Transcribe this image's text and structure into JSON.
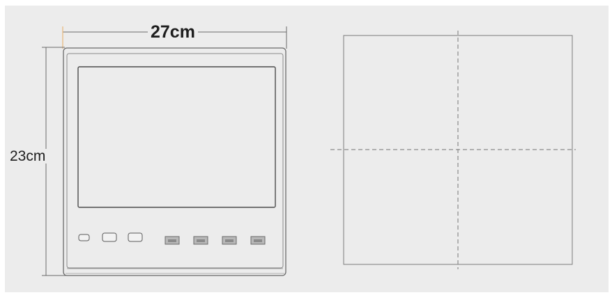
{
  "dimensions": {
    "width_label": "27cm",
    "height_label": "23cm"
  },
  "colors": {
    "background": "#ececec",
    "line": "#5a5a5a",
    "dashed": "#8a8a8a",
    "button_fill": "#b8b8b8",
    "accent_tick": "#e8b878"
  },
  "device": {
    "buttons": [
      {
        "name": "left-key-1",
        "style": "outline"
      },
      {
        "name": "left-key-2",
        "style": "outline"
      },
      {
        "name": "left-key-3",
        "style": "outline"
      },
      {
        "name": "right-key-1",
        "style": "filled"
      },
      {
        "name": "right-key-2",
        "style": "filled"
      },
      {
        "name": "right-key-3",
        "style": "filled"
      },
      {
        "name": "right-key-4",
        "style": "filled"
      }
    ]
  }
}
